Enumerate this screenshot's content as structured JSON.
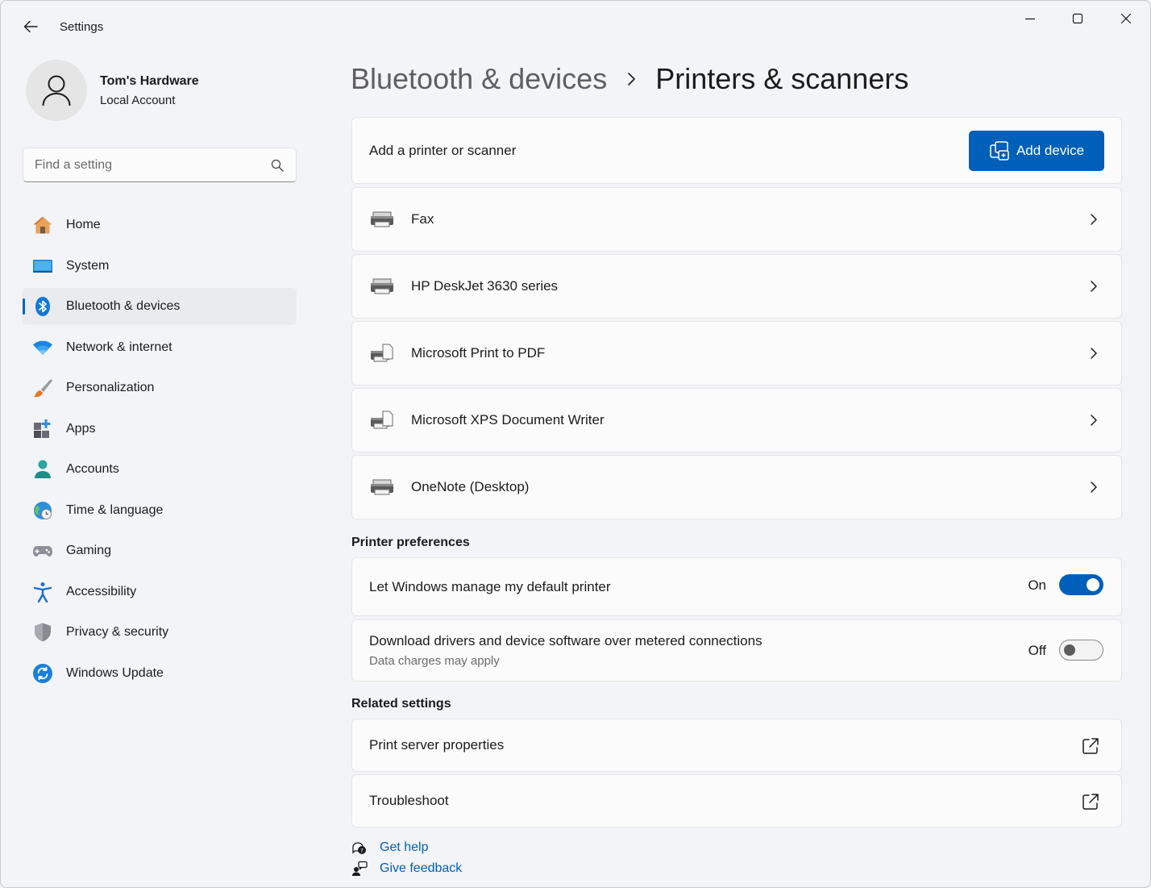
{
  "window": {
    "app_title": "Settings",
    "icons": {
      "back": "back-arrow-icon",
      "minimize": "minimize-icon",
      "maximize": "maximize-icon",
      "close": "close-icon"
    }
  },
  "profile": {
    "name": "Tom's Hardware",
    "account_type": "Local Account"
  },
  "search": {
    "placeholder": "Find a setting"
  },
  "sidebar": {
    "items": [
      {
        "label": "Home",
        "icon": "home-icon"
      },
      {
        "label": "System",
        "icon": "system-icon"
      },
      {
        "label": "Bluetooth & devices",
        "icon": "bluetooth-icon",
        "active": true
      },
      {
        "label": "Network & internet",
        "icon": "wifi-icon"
      },
      {
        "label": "Personalization",
        "icon": "brush-icon"
      },
      {
        "label": "Apps",
        "icon": "apps-icon"
      },
      {
        "label": "Accounts",
        "icon": "accounts-icon"
      },
      {
        "label": "Time & language",
        "icon": "globe-clock-icon"
      },
      {
        "label": "Gaming",
        "icon": "gamepad-icon"
      },
      {
        "label": "Accessibility",
        "icon": "accessibility-icon"
      },
      {
        "label": "Privacy & security",
        "icon": "shield-icon"
      },
      {
        "label": "Windows Update",
        "icon": "update-icon"
      }
    ]
  },
  "breadcrumb": {
    "parent": "Bluetooth & devices",
    "current": "Printers & scanners"
  },
  "add_device": {
    "label": "Add a printer or scanner",
    "button_label": "Add device"
  },
  "devices": [
    {
      "name": "Fax",
      "icon": "printer-icon"
    },
    {
      "name": "HP DeskJet 3630 series",
      "icon": "printer-icon"
    },
    {
      "name": "Microsoft Print to PDF",
      "icon": "printer-document-icon"
    },
    {
      "name": "Microsoft XPS Document Writer",
      "icon": "printer-document-icon"
    },
    {
      "name": "OneNote (Desktop)",
      "icon": "printer-icon"
    }
  ],
  "printer_preferences": {
    "title": "Printer preferences",
    "manage_default": {
      "label": "Let Windows manage my default printer",
      "state": "On",
      "enabled": true
    },
    "metered_download": {
      "label": "Download drivers and device software over metered connections",
      "sublabel": "Data charges may apply",
      "state": "Off",
      "enabled": false
    }
  },
  "related_settings": {
    "title": "Related settings",
    "items": [
      {
        "label": "Print server properties",
        "icon": "external-link-icon"
      },
      {
        "label": "Troubleshoot",
        "icon": "external-link-icon"
      }
    ]
  },
  "footer": {
    "get_help": "Get help",
    "give_feedback": "Give feedback"
  },
  "colors": {
    "accent": "#005fb8",
    "background": "#f3f4f7",
    "card": "#fbfbfc"
  }
}
